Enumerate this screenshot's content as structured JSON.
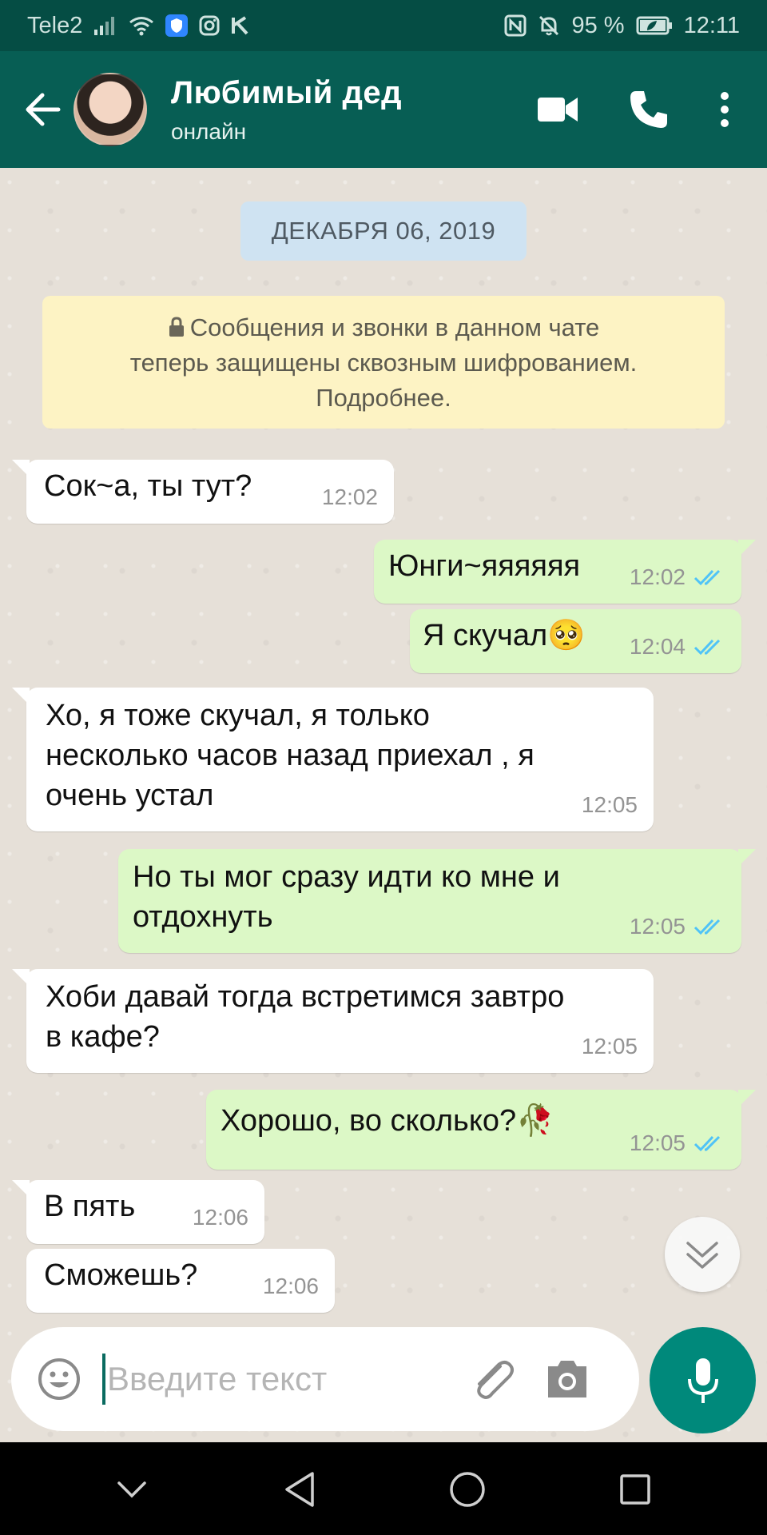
{
  "status_bar": {
    "carrier": "Tele2",
    "battery_percent": "95 %",
    "time": "12:11"
  },
  "header": {
    "contact_name": "Любимый дед",
    "contact_status": "онлайн"
  },
  "chat": {
    "date_label": "ДЕКАБРЯ 06, 2019",
    "encryption_notice": {
      "line1": "Сообщения и звонки в данном чате",
      "line2": "теперь защищены сквозным шифрованием.",
      "line3": "Подробнее."
    },
    "messages": [
      {
        "direction": "in",
        "text": "Сок~а, ты тут?",
        "time": "12:02"
      },
      {
        "direction": "out",
        "text": "Юнги~яяяяяя",
        "time": "12:02",
        "status": "read"
      },
      {
        "direction": "out",
        "text": "Я скучал",
        "emoji": "🥺",
        "time": "12:04",
        "status": "read"
      },
      {
        "direction": "in",
        "line1": "Хо, я тоже скучал, я только",
        "line2": "несколько часов назад приехал , я",
        "line3": "очень устал",
        "time": "12:05"
      },
      {
        "direction": "out",
        "line1": "Но ты мог сразу идти ко мне и",
        "line2": "отдохнуть",
        "time": "12:05",
        "status": "read"
      },
      {
        "direction": "in",
        "line1": "Хоби давай тогда встретимся завтро",
        "line2": "в кафе?",
        "time": "12:05"
      },
      {
        "direction": "out",
        "text": "Хорошо, во сколько?",
        "emoji": "🥀",
        "time": "12:05",
        "status": "read"
      },
      {
        "direction": "in",
        "text": "В пять",
        "time": "12:06"
      },
      {
        "direction": "in",
        "text": "Сможешь?",
        "time": "12:06"
      }
    ]
  },
  "composer": {
    "placeholder": "Введите текст",
    "value": ""
  },
  "colors": {
    "header_bg": "#075e54",
    "statusbar_bg": "#054d44",
    "outgoing_bubble": "#dcf8c6",
    "incoming_bubble": "#ffffff",
    "read_ticks": "#4fc3f7",
    "mic_button": "#00897b",
    "notice_bg": "#fdf3c4",
    "date_chip_bg": "#cfe3f2"
  }
}
